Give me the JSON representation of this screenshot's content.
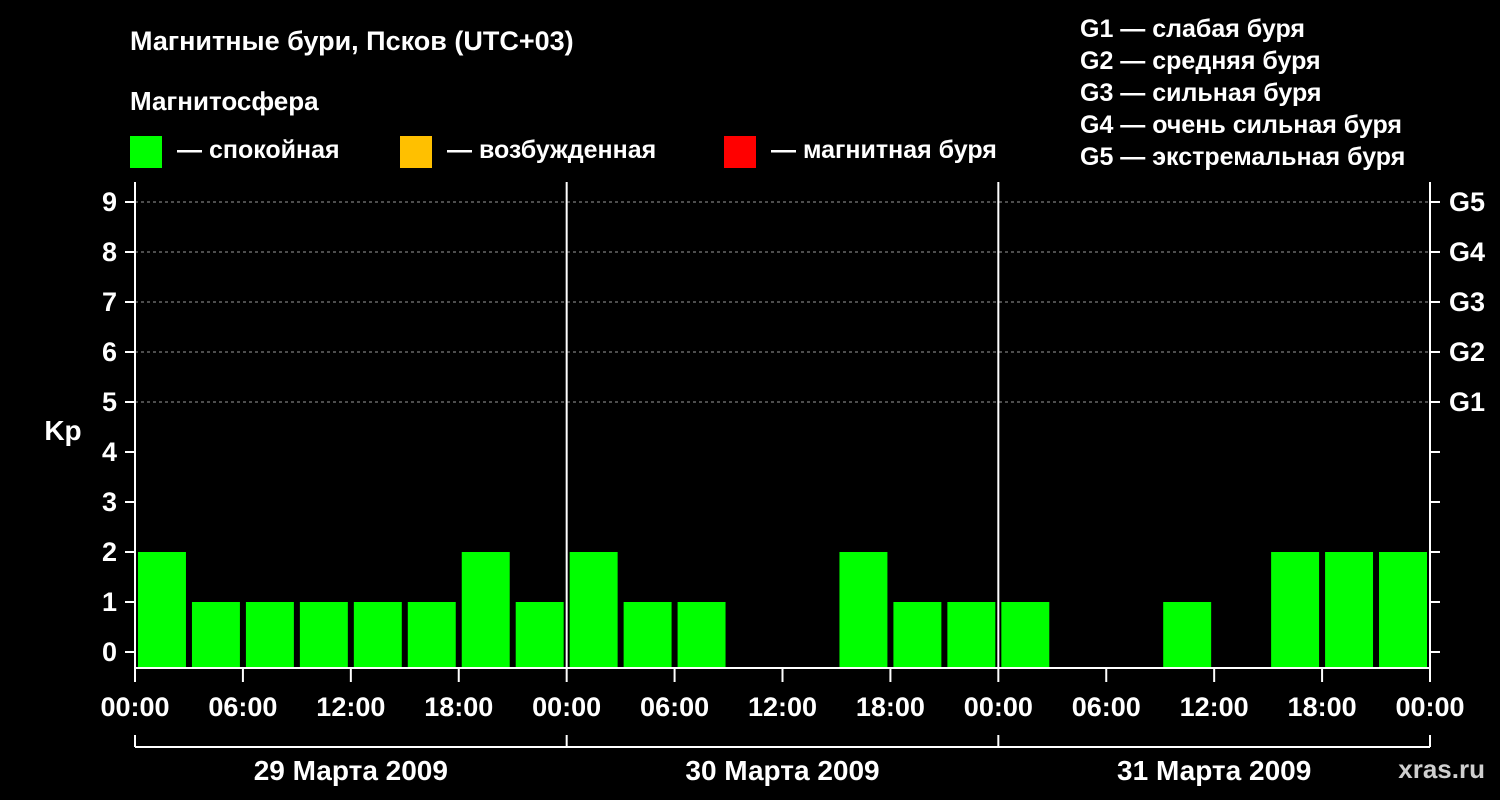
{
  "title": "Магнитные бури, Псков (UTC+03)",
  "legend": {
    "heading": "Магнитосфера",
    "items": [
      {
        "label": "— спокойная",
        "color": "#00ff00"
      },
      {
        "label": "— возбужденная",
        "color": "#ffc000"
      },
      {
        "label": "— магнитная буря",
        "color": "#ff0000"
      }
    ]
  },
  "g_scale": [
    {
      "label": "G1 — слабая буря"
    },
    {
      "label": "G2 — средняя буря"
    },
    {
      "label": "G3 — сильная буря"
    },
    {
      "label": "G4 — очень сильная буря"
    },
    {
      "label": "G5 — экстремальная буря"
    }
  ],
  "watermark": "xras.ru",
  "chart_data": {
    "type": "bar",
    "ylabel": "Kp",
    "ylim": [
      0,
      9
    ],
    "y_ticks": [
      "0",
      "1",
      "2",
      "3",
      "4",
      "5",
      "6",
      "7",
      "8",
      "9"
    ],
    "right_ticks": [
      {
        "kp": 5,
        "label": "G1"
      },
      {
        "kp": 6,
        "label": "G2"
      },
      {
        "kp": 7,
        "label": "G3"
      },
      {
        "kp": 8,
        "label": "G4"
      },
      {
        "kp": 9,
        "label": "G5"
      }
    ],
    "grid": "dashed horizontal lines at Kp 5–9",
    "x_tick_labels": [
      "00:00",
      "06:00",
      "12:00",
      "18:00",
      "00:00",
      "06:00",
      "12:00",
      "18:00",
      "00:00",
      "06:00",
      "12:00",
      "18:00",
      "00:00"
    ],
    "days": [
      "29 Марта 2009",
      "30 Марта 2009",
      "31 Марта 2009"
    ],
    "interval_hours": 3,
    "values": [
      2,
      1,
      1,
      1,
      1,
      1,
      2,
      1,
      2,
      1,
      1,
      0,
      0,
      2,
      1,
      1,
      1,
      0,
      0,
      1,
      0,
      2,
      2,
      2
    ],
    "bar_color": "#00ff00"
  }
}
